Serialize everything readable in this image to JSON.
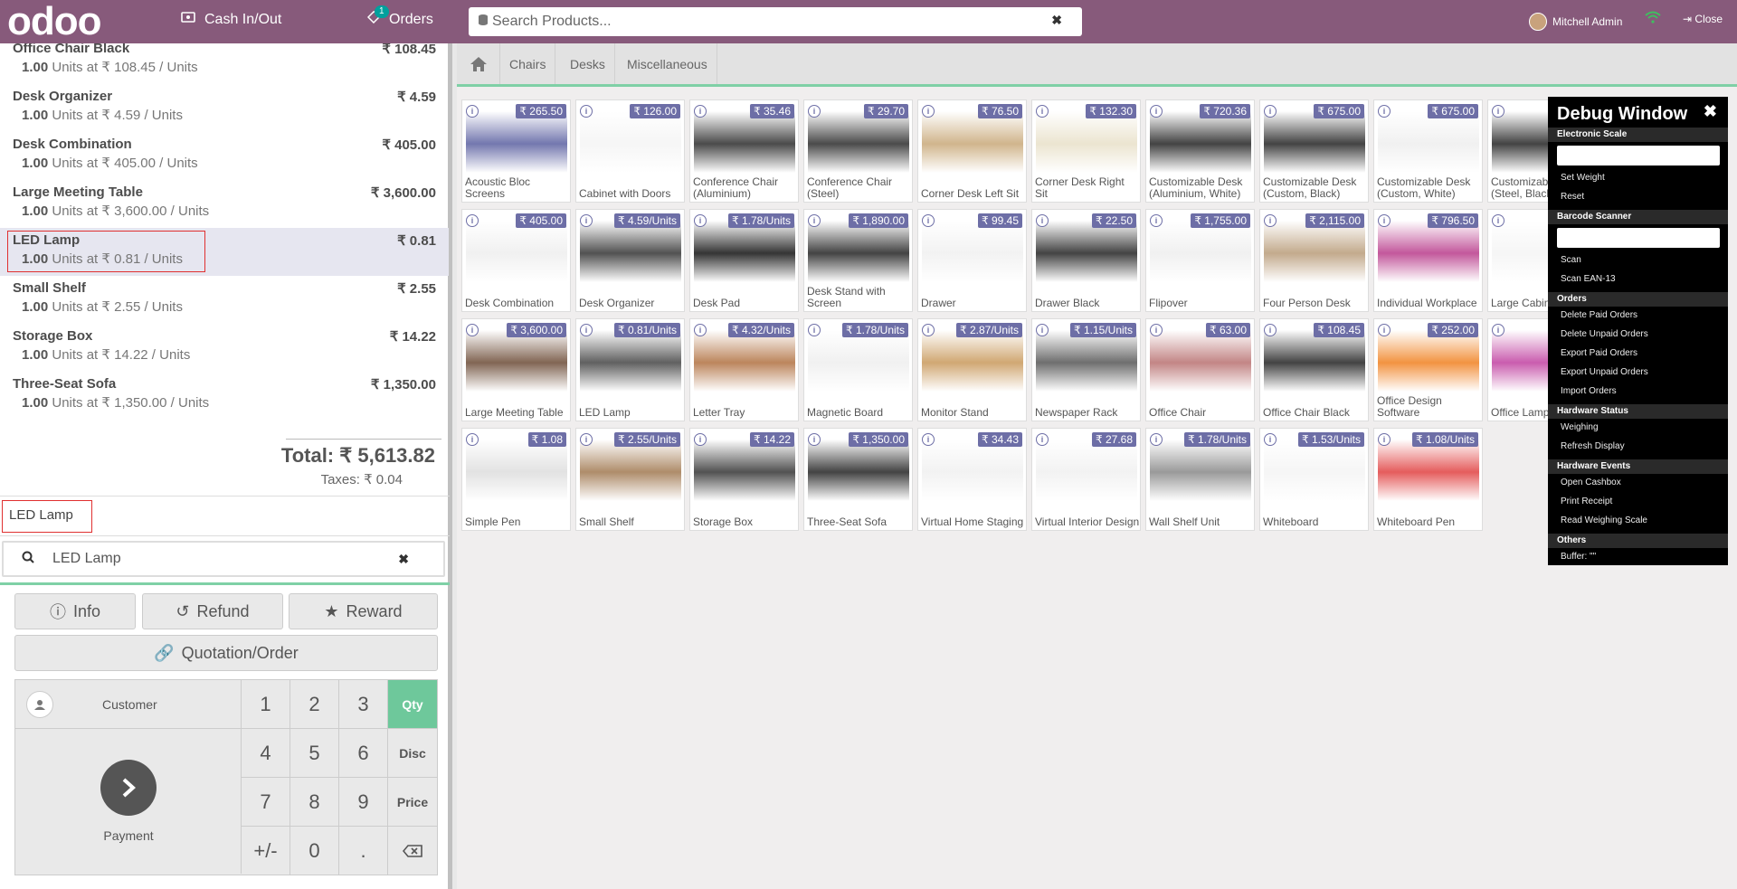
{
  "header": {
    "logo": "odoo",
    "cash_label": "Cash In/Out",
    "orders_label": "Orders",
    "orders_count": "1",
    "search_placeholder": "Search Products...",
    "user_name": "Mitchell Admin",
    "close_label": "Close"
  },
  "order": {
    "lines": [
      {
        "name": "Office Chair Black",
        "price": "₹ 108.45",
        "qty": "1.00",
        "detail": "Units at ₹ 108.45 / Units"
      },
      {
        "name": "Desk Organizer",
        "price": "₹ 4.59",
        "qty": "1.00",
        "detail": "Units at ₹ 4.59 / Units"
      },
      {
        "name": "Desk Combination",
        "price": "₹ 405.00",
        "qty": "1.00",
        "detail": "Units at ₹ 405.00 / Units"
      },
      {
        "name": "Large Meeting Table",
        "price": "₹ 3,600.00",
        "qty": "1.00",
        "detail": "Units at ₹ 3,600.00 / Units"
      },
      {
        "name": "LED Lamp",
        "price": "₹ 0.81",
        "qty": "1.00",
        "detail": "Units at ₹ 0.81 / Units"
      },
      {
        "name": "Small Shelf",
        "price": "₹ 2.55",
        "qty": "1.00",
        "detail": "Units at ₹ 2.55 / Units"
      },
      {
        "name": "Storage Box",
        "price": "₹ 14.22",
        "qty": "1.00",
        "detail": "Units at ₹ 14.22 / Units"
      },
      {
        "name": "Three-Seat Sofa",
        "price": "₹ 1,350.00",
        "qty": "1.00",
        "detail": "Units at ₹ 1,350.00 / Units"
      }
    ],
    "total": "Total: ₹ 5,613.82",
    "taxes": "Taxes: ₹ 0.04",
    "note": "LED Lamp",
    "search_value": "LED Lamp"
  },
  "controls": {
    "info": "Info",
    "refund": "Refund",
    "reward": "Reward",
    "quotation": "Quotation/Order",
    "customer": "Customer",
    "payment": "Payment"
  },
  "numpad": {
    "keys": [
      "1",
      "2",
      "3",
      "4",
      "5",
      "6",
      "7",
      "8",
      "9",
      "+/-",
      "0",
      "."
    ],
    "modes": [
      "Qty",
      "Disc",
      "Price"
    ]
  },
  "categories": [
    "Chairs",
    "Desks",
    "Miscellaneous"
  ],
  "products": [
    {
      "name": "Acoustic Bloc Screens",
      "price": "₹ 265.50"
    },
    {
      "name": "Cabinet with Doors",
      "price": "₹ 126.00"
    },
    {
      "name": "Conference Chair (Aluminium)",
      "price": "₹ 35.46"
    },
    {
      "name": "Conference Chair (Steel)",
      "price": "₹ 29.70"
    },
    {
      "name": "Corner Desk Left Sit",
      "price": "₹ 76.50"
    },
    {
      "name": "Corner Desk Right Sit",
      "price": "₹ 132.30"
    },
    {
      "name": "Customizable Desk (Aluminium, White)",
      "price": "₹ 720.36"
    },
    {
      "name": "Customizable Desk (Custom, Black)",
      "price": "₹ 675.00"
    },
    {
      "name": "Customizable Desk (Custom, White)",
      "price": "₹ 675.00"
    },
    {
      "name": "Customizable Desk (Steel, Black)",
      "price": ""
    },
    {
      "name": "Desk Combination",
      "price": "₹ 405.00"
    },
    {
      "name": "Desk Organizer",
      "price": "₹ 4.59/Units"
    },
    {
      "name": "Desk Pad",
      "price": "₹ 1.78/Units"
    },
    {
      "name": "Desk Stand with Screen",
      "price": "₹ 1,890.00"
    },
    {
      "name": "Drawer",
      "price": "₹ 99.45"
    },
    {
      "name": "Drawer Black",
      "price": "₹ 22.50"
    },
    {
      "name": "Flipover",
      "price": "₹ 1,755.00"
    },
    {
      "name": "Four Person Desk",
      "price": "₹ 2,115.00"
    },
    {
      "name": "Individual Workplace",
      "price": "₹ 796.50"
    },
    {
      "name": "Large Cabinet",
      "price": ""
    },
    {
      "name": "Large Meeting Table",
      "price": "₹ 3,600.00"
    },
    {
      "name": "LED Lamp",
      "price": "₹ 0.81/Units"
    },
    {
      "name": "Letter Tray",
      "price": "₹ 4.32/Units"
    },
    {
      "name": "Magnetic Board",
      "price": "₹ 1.78/Units"
    },
    {
      "name": "Monitor Stand",
      "price": "₹ 2.87/Units"
    },
    {
      "name": "Newspaper Rack",
      "price": "₹ 1.15/Units"
    },
    {
      "name": "Office Chair",
      "price": "₹ 63.00"
    },
    {
      "name": "Office Chair Black",
      "price": "₹ 108.45"
    },
    {
      "name": "Office Design Software",
      "price": "₹ 252.00"
    },
    {
      "name": "Office Lamp",
      "price": ""
    },
    {
      "name": "Simple Pen",
      "price": "₹ 1.08"
    },
    {
      "name": "Small Shelf",
      "price": "₹ 2.55/Units"
    },
    {
      "name": "Storage Box",
      "price": "₹ 14.22"
    },
    {
      "name": "Three-Seat Sofa",
      "price": "₹ 1,350.00"
    },
    {
      "name": "Virtual Home Staging",
      "price": "₹ 34.43"
    },
    {
      "name": "Virtual Interior Design",
      "price": "₹ 27.68"
    },
    {
      "name": "Wall Shelf Unit",
      "price": "₹ 1.78/Units"
    },
    {
      "name": "Whiteboard",
      "price": "₹ 1.53/Units"
    },
    {
      "name": "Whiteboard Pen",
      "price": "₹ 1.08/Units"
    }
  ],
  "debug": {
    "title": "Debug Window",
    "sections": [
      {
        "label": "Electronic Scale",
        "has_input": true,
        "items": [
          "Set Weight",
          "Reset"
        ]
      },
      {
        "label": "Barcode Scanner",
        "has_input": true,
        "items": [
          "Scan",
          "Scan EAN-13"
        ]
      },
      {
        "label": "Orders",
        "has_input": false,
        "items": [
          "Delete Paid Orders",
          "Delete Unpaid Orders",
          "Export Paid Orders",
          "Export Unpaid Orders",
          "Import Orders"
        ]
      },
      {
        "label": "Hardware Status",
        "has_input": false,
        "items": [
          "Weighing",
          "Refresh Display"
        ]
      },
      {
        "label": "Hardware Events",
        "has_input": false,
        "items": [
          "Open Cashbox",
          "Print Receipt",
          "Read Weighing Scale"
        ]
      },
      {
        "label": "Others",
        "has_input": false,
        "items": [
          "Buffer: \"\""
        ]
      }
    ]
  },
  "colors": {
    "brand": "#875a7b",
    "accent": "#6ec89b",
    "price_tag": "#6d6ea6"
  }
}
